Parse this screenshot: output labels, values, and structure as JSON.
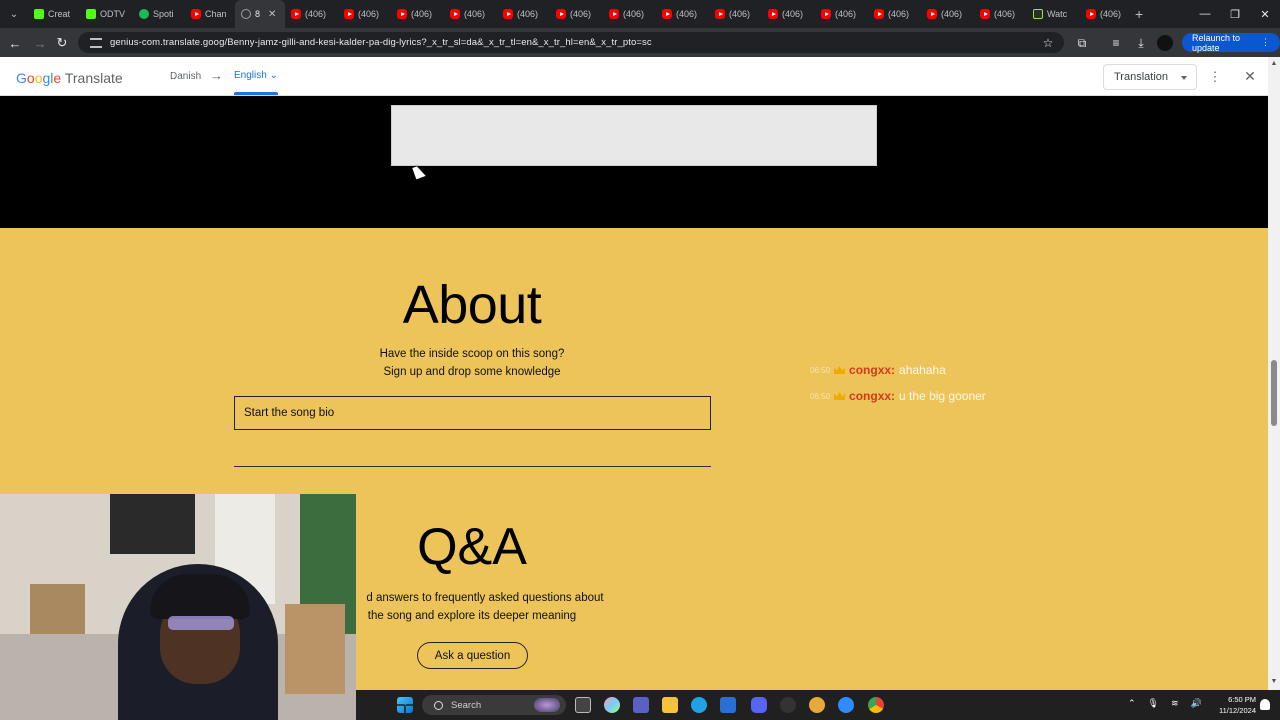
{
  "browser": {
    "tabs": [
      {
        "label": "Creat",
        "icon": "kick-icon"
      },
      {
        "label": "ODTV",
        "icon": "kick-icon"
      },
      {
        "label": "Spoti",
        "icon": "spotify-icon"
      },
      {
        "label": "Chan",
        "icon": "youtube-icon"
      },
      {
        "label": "8",
        "icon": "loading-icon",
        "active": true
      },
      {
        "label": "(406)",
        "icon": "youtube-icon"
      },
      {
        "label": "(406)",
        "icon": "youtube-icon"
      },
      {
        "label": "(406)",
        "icon": "youtube-icon"
      },
      {
        "label": "(406)",
        "icon": "youtube-icon"
      },
      {
        "label": "(406)",
        "icon": "youtube-icon"
      },
      {
        "label": "(406)",
        "icon": "youtube-icon"
      },
      {
        "label": "(406)",
        "icon": "youtube-icon"
      },
      {
        "label": "(406)",
        "icon": "youtube-icon"
      },
      {
        "label": "(406)",
        "icon": "youtube-icon"
      },
      {
        "label": "(406)",
        "icon": "youtube-icon"
      },
      {
        "label": "(406)",
        "icon": "youtube-icon"
      },
      {
        "label": "(406)",
        "icon": "youtube-icon"
      },
      {
        "label": "(406)",
        "icon": "youtube-icon"
      },
      {
        "label": "(406)",
        "icon": "youtube-icon"
      },
      {
        "label": "Watc",
        "icon": "feed-icon"
      },
      {
        "label": "(406)",
        "icon": "youtube-icon"
      }
    ],
    "url": "genius-com.translate.goog/Benny-jamz-gilli-and-kesi-kalder-pa-dig-lyrics?_x_tr_sl=da&_x_tr_tl=en&_x_tr_hl=en&_x_tr_pto=sc",
    "relaunch_label": "Relaunch to update"
  },
  "translate_bar": {
    "logo_google": [
      "G",
      "o",
      "o",
      "g",
      "l",
      "e"
    ],
    "logo_translate": "Translate",
    "source_lang": "Danish",
    "arrow": "→",
    "target_lang": "English",
    "mode_label": "Translation"
  },
  "about": {
    "title": "About",
    "line1": "Have the inside scoop on this song?",
    "line2": "Sign up and drop some knowledge",
    "bio_button": "Start the song bio"
  },
  "qa": {
    "title": "Q&A",
    "line1": "d answers to frequently asked questions about",
    "line2": "the song and explore its deeper meaning",
    "ask_button": "Ask a question"
  },
  "chat": [
    {
      "time": "06:50",
      "user": "congxx:",
      "message": "ahahaha"
    },
    {
      "time": "06:50",
      "user": "congxx:",
      "message": "u the big gooner"
    }
  ],
  "taskbar": {
    "search_label": "Search",
    "time": "6:50 PM",
    "date": "11/12/2024"
  },
  "colors": {
    "page_yellow": "#ecc45a",
    "chat_user": "#d33a1a",
    "translate_blue": "#1a73e8"
  }
}
